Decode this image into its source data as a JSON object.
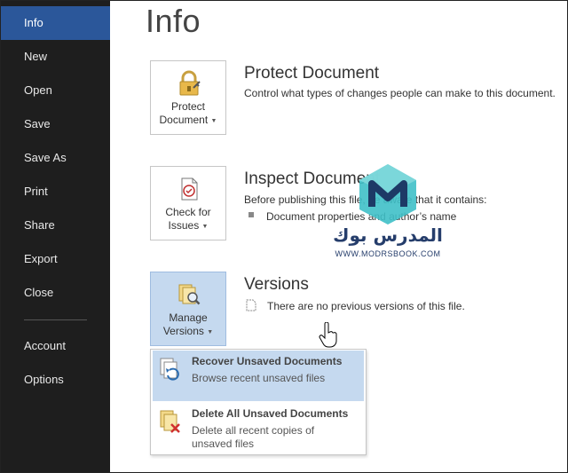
{
  "sidebar": {
    "items": [
      {
        "label": "Info"
      },
      {
        "label": "New"
      },
      {
        "label": "Open"
      },
      {
        "label": "Save"
      },
      {
        "label": "Save As"
      },
      {
        "label": "Print"
      },
      {
        "label": "Share"
      },
      {
        "label": "Export"
      },
      {
        "label": "Close"
      },
      {
        "label": "Account"
      },
      {
        "label": "Options"
      }
    ],
    "active_color": "#2b579a",
    "background_color": "#1e1e1e"
  },
  "main": {
    "title": "Info",
    "protect": {
      "button_line1": "Protect",
      "button_line2": "Document",
      "title": "Protect Document",
      "description": "Control what types of changes people can make to this document."
    },
    "inspect": {
      "button_line1": "Check for",
      "button_line2": "Issues",
      "title": "Inspect Document",
      "description": "Before publishing this file, be aware that it contains:",
      "bullet": "Document properties and author’s name"
    },
    "versions": {
      "button_line1": "Manage",
      "button_line2": "Versions",
      "title": "Versions",
      "description": "There are no previous versions of this file."
    }
  },
  "versions_menu": {
    "items": [
      {
        "title": "Recover Unsaved Documents",
        "description": "Browse recent unsaved files",
        "icon": "recover-documents-icon",
        "highlighted": true
      },
      {
        "title": "Delete All Unsaved Documents",
        "description": "Delete all recent copies of unsaved files",
        "icon": "delete-documents-icon",
        "highlighted": false
      }
    ],
    "highlight_color": "#c5d9ef"
  },
  "watermark": {
    "arabic": "المدرس بوك",
    "url": "WWW.MODRSBOOK.COM"
  }
}
